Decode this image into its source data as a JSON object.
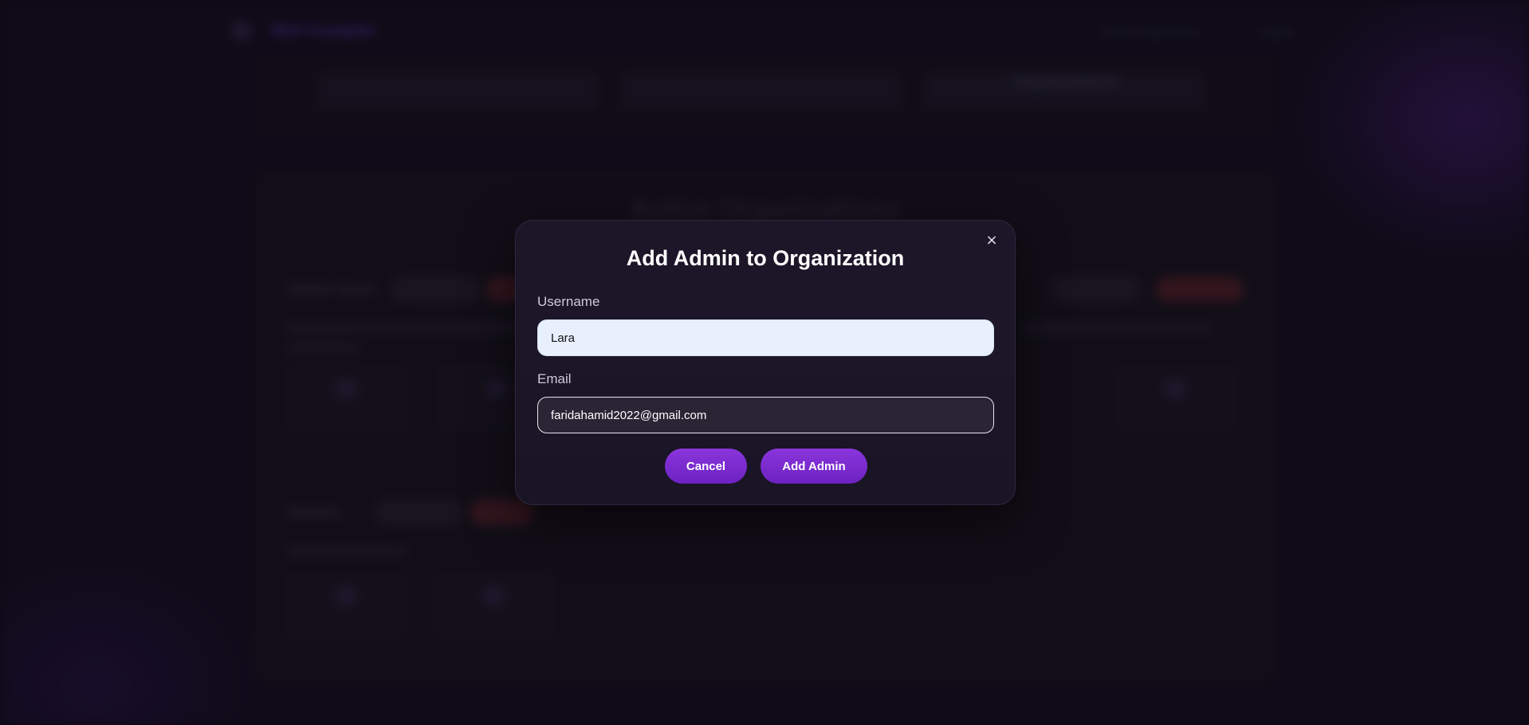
{
  "background": {
    "brand": "Mini Compiler",
    "nav_links": [
      "Create Organization",
      "Logout"
    ],
    "filter_label": "Organizations",
    "panel_title": "Active Organizations",
    "organizations": [
      {
        "name": "Admin Users",
        "pill_labels": [
          "Edit Admin",
          "Delete"
        ]
      },
      {
        "name": "Admins",
        "pill_labels": [
          "Edit Admin",
          "Delete"
        ]
      }
    ]
  },
  "modal": {
    "title": "Add Admin to Organization",
    "close_icon": "×",
    "username_label": "Username",
    "username_value": "Lara",
    "email_label": "Email",
    "email_value": "faridahamid2022@gmail.com",
    "cancel_label": "Cancel",
    "submit_label": "Add Admin"
  },
  "colors": {
    "accent": "#7b2bd0",
    "modal_bg": "#1b1527",
    "page_bg": "#110e1a"
  }
}
